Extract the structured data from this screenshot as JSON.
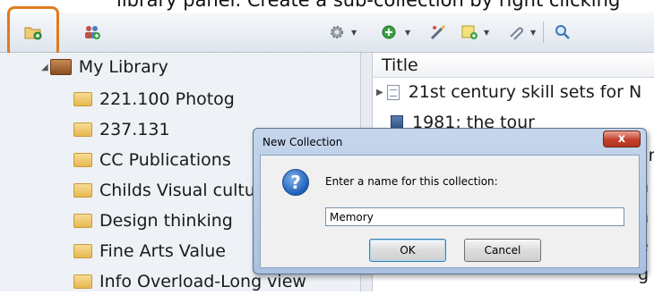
{
  "caption": "library panel. Create a sub-collection by right clicking",
  "toolbar": {
    "icons": [
      "new-collection-icon",
      "new-group-icon",
      "gear-icon",
      "new-item-icon",
      "wand-icon",
      "add-note-icon",
      "attach-icon",
      "search-icon"
    ],
    "highlight_color": "#e07a1f"
  },
  "library": {
    "root_label": "My Library",
    "collections": [
      "221.100 Photog",
      "237.131",
      "CC Publications",
      "Childs Visual cultu",
      "Design thinking",
      "Fine Arts Value",
      "Info Overload-Long view"
    ]
  },
  "items": {
    "column_title": "Title",
    "rows": [
      "21st century skill sets for N",
      "1981: the tour"
    ],
    "partial_right": [
      "ar",
      "n",
      "h",
      "e",
      "g"
    ]
  },
  "dialog": {
    "title": "New Collection",
    "close_label": "x",
    "prompt": "Enter a name for this collection:",
    "input_value": "Memory",
    "ok_label": "OK",
    "cancel_label": "Cancel"
  }
}
